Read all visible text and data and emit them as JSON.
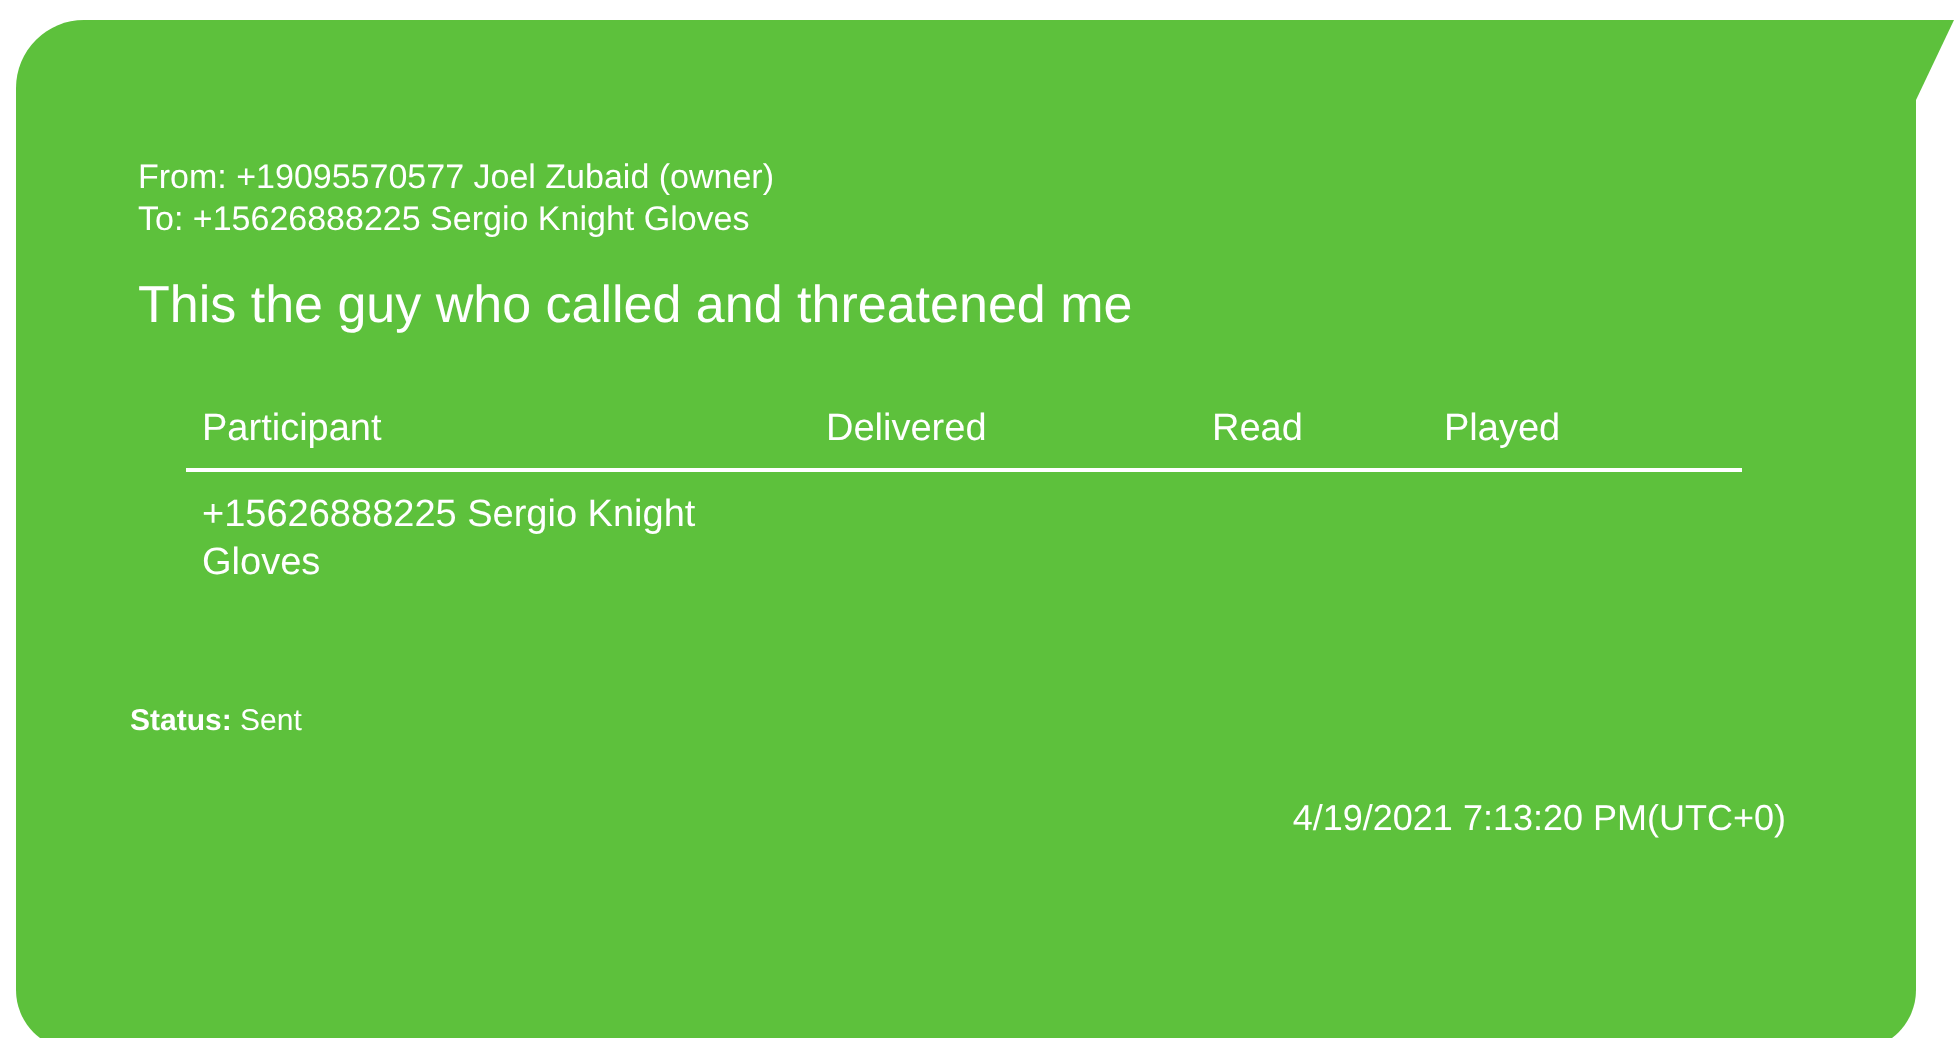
{
  "message": {
    "from": "From: +19095570577 Joel Zubaid (owner)",
    "to": "To: +15626888225 Sergio Knight Gloves",
    "body": "This the guy who called and threatened me",
    "table": {
      "columns": [
        "Participant",
        "Delivered",
        "Read",
        "Played"
      ],
      "rows": [
        [
          "+15626888225 Sergio Knight Gloves",
          "",
          "",
          ""
        ]
      ]
    },
    "status": "**Status:** Sent",
    "timestamp": "4/19/2021 7:13:20 PM(UTC+0)"
  }
}
